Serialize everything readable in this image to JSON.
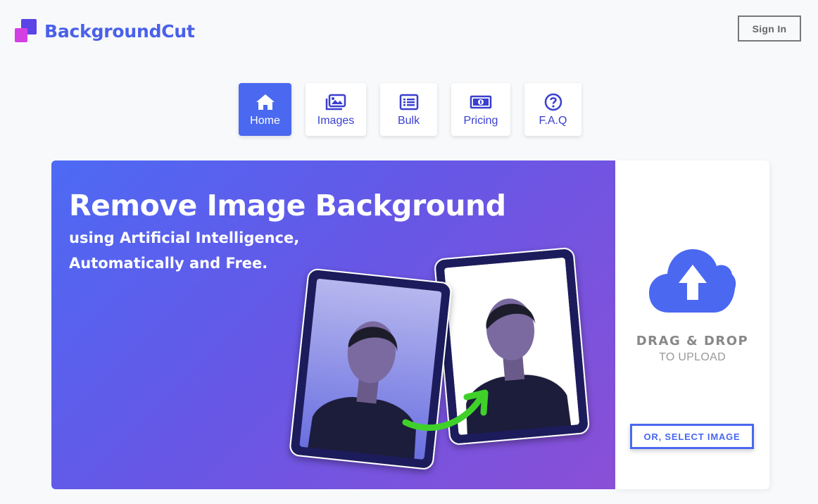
{
  "brand": {
    "name": "BackgroundCut"
  },
  "header": {
    "signin_label": "Sign In"
  },
  "nav": {
    "tabs": [
      {
        "label": "Home",
        "icon": "home-icon",
        "active": true
      },
      {
        "label": "Images",
        "icon": "images-icon",
        "active": false
      },
      {
        "label": "Bulk",
        "icon": "list-icon",
        "active": false
      },
      {
        "label": "Pricing",
        "icon": "money-icon",
        "active": false
      },
      {
        "label": "F.A.Q",
        "icon": "question-icon",
        "active": false
      }
    ]
  },
  "hero": {
    "title": "Remove Image Background",
    "subtitle_line1": "using Artificial Intelligence,",
    "subtitle_line2": "Automatically and Free."
  },
  "upload": {
    "icon": "cloud-upload-icon",
    "title": "DRAG & DROP",
    "subtitle": "TO UPLOAD",
    "select_label": "OR, SELECT IMAGE"
  },
  "colors": {
    "accent": "#4a68f0",
    "brand_text": "#4a60ea",
    "arrow_green": "#3fd12a",
    "gradient_start": "#4d6af4",
    "gradient_end": "#8a4fd6"
  }
}
